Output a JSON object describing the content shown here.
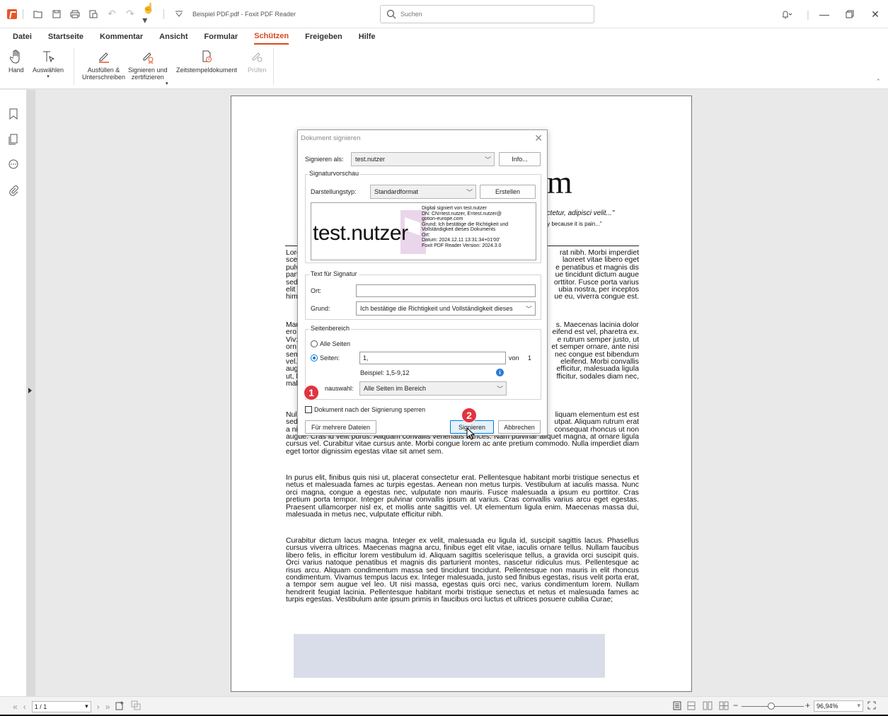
{
  "titlebar": {
    "title": "Beispiel PDF.pdf - Foxit PDF Reader",
    "search_placeholder": "Suchen"
  },
  "menu": [
    "Datei",
    "Startseite",
    "Kommentar",
    "Ansicht",
    "Formular",
    "Schützen",
    "Freigeben",
    "Hilfe"
  ],
  "menu_active": "Schützen",
  "ribbon": {
    "hand": "Hand",
    "select": "Auswählen",
    "fill_sign_1": "Ausfüllen &",
    "fill_sign_2": "Unterschreiben",
    "sign_cert_1": "Signieren und",
    "sign_cert_2": "zertifizieren",
    "timestamp": "Zeitstempeldokument",
    "verify": "Prüfen"
  },
  "pdf": {
    "big_letter": "m",
    "quote1": "ectetur, adipisci velit...\"",
    "quote2": "ply because it is pain...\"",
    "col_left": [
      "Lore",
      "sce",
      "pulv",
      "part",
      "sed",
      "elit",
      "him"
    ],
    "col_right": [
      "rat nibh. Morbi imperdiet",
      "laoreet vitae libero eget",
      "e penatibus et magnis dis",
      "ue tincidunt dictum augue",
      "orttitor. Fusce porta varius",
      "ubia nostra, per inceptos",
      "ue eu, viverra congue est."
    ],
    "p2_left": [
      "Mau",
      "ero:",
      "Viv:",
      "orn:",
      "sem",
      "vel.",
      "aug",
      "ut, l",
      "mal"
    ],
    "p2_right": [
      "s. Maecenas lacinia dolor",
      "eifend est vel, pharetra ex.",
      "e rutrum semper justo, ut",
      "et semper ornare, ante nisi",
      "nec congue est bibendum",
      "eleifend. Morbi convallis",
      "efficitur, malesuada ligula",
      "fficitur, sodales diam nec,",
      ""
    ],
    "p3_left": [
      "Nul",
      "sed",
      "a ni"
    ],
    "p3_right": [
      "liquam elementum est est",
      "utpat. Aliquam rutrum erat",
      "consequat rhoncus ut non"
    ],
    "p3_rest": "augue. Cras id velit purus. Aliquam convallis venenatis ultrices. Nam pulvinar aliquet magna, at ornare ligula cursus vel. Curabitur vitae cursus ante. Morbi congue lorem ac ante pretium commodo. Nulla imperdiet diam eget tortor dignissim egestas vitae sit amet sem.",
    "p4": "In purus elit, finibus quis nisi ut, placerat consectetur erat. Pellentesque habitant morbi tristique senectus et netus et malesuada fames ac turpis egestas. Aenean non metus turpis. Vestibulum at iaculis massa. Nunc orci magna, congue a egestas nec, vulputate non mauris. Fusce malesuada a ipsum eu porttitor. Cras pretium porta tempor. Integer pulvinar convallis ipsum at varius. Cras convallis varius arcu eget egestas. Praesent ullamcorper nisl ex, et mollis ante sagittis vel. Ut elementum ligula enim. Maecenas massa dui, malesuada in metus nec, vulputate efficitur nibh.",
    "p5": "Curabitur dictum lacus magna. Integer ex velit, malesuada eu ligula id, suscipit sagittis lacus. Phasellus cursus viverra ultrices. Maecenas magna arcu, finibus eget elit vitae, iaculis ornare tellus. Nullam faucibus libero felis, in efficitur lorem vestibulum id. Aliquam sagittis scelerisque tellus, a gravida orci suscipit quis. Orci varius natoque penatibus et magnis dis parturient montes, nascetur ridiculus mus. Pellentesque ac risus arcu. Aliquam condimentum massa sed tincidunt tincidunt. Pellentesque non mauris in elit rhoncus condimentum. Vivamus tempus lacus ex. Integer malesuada, justo sed finibus egestas, risus velit porta erat, a tempor sem augue vel leo. Ut nisi massa, egestas quis orci nec, varius condimentum lorem. Nullam hendrerit feugiat lacinia. Pellentesque habitant morbi tristique senectus et netus et malesuada fames ac turpis egestas. Vestibulum ante ipsum primis in faucibus orci luctus et ultrices posuere cubilia Curae;"
  },
  "dialog": {
    "title": "Dokument signieren",
    "sign_as_label": "Signieren als:",
    "sign_as_value": "test.nutzer",
    "info_button": "Info...",
    "preview_group": "Signaturvorschau",
    "display_type_label": "Darstellungstyp:",
    "display_type_value": "Standardformat",
    "create_button": "Erstellen",
    "preview_name": "test.nutzer",
    "preview_lines": [
      "Digital signiert von test.nutzer",
      "DN: CN=test.nutzer, E=test.nutzer@",
      "gotion-europe.com",
      "Grund: Ich bestätige die Richtigkeit und",
      "Vollständigkeit dieses Dokuments",
      "Ort:",
      "Datum: 2024.12.11 13:31:34+01'00'",
      "Foxit PDF Reader Version: 2024.3.0"
    ],
    "text_group": "Text für Signatur",
    "location_label": "Ort:",
    "location_value": "",
    "reason_label": "Grund:",
    "reason_value": "Ich bestätige die Richtigkeit und Vollständigkeit dieses",
    "page_range_group": "Seitenbereich",
    "all_pages": "Alle Seiten",
    "pages_label": "Seiten:",
    "pages_value": "1,",
    "of_label": "von",
    "of_value": "1",
    "example": "Beispiel: 1,5-9,12",
    "subset_label": "nauswahl:",
    "subset_value": "Alle Seiten im Bereich",
    "lock_label": "Dokument nach der Signierung sperren",
    "multi_files_button": "Für mehrere Dateien",
    "sign_button": "Signieren",
    "cancel_button": "Abbrechen"
  },
  "badges": [
    "1",
    "2"
  ],
  "statusbar": {
    "page_value": "1 / 1",
    "zoom_value": "96,94%"
  },
  "colors": {
    "accent": "#d8491f",
    "badge": "#e1343f",
    "primary_button": "#0078d7"
  }
}
